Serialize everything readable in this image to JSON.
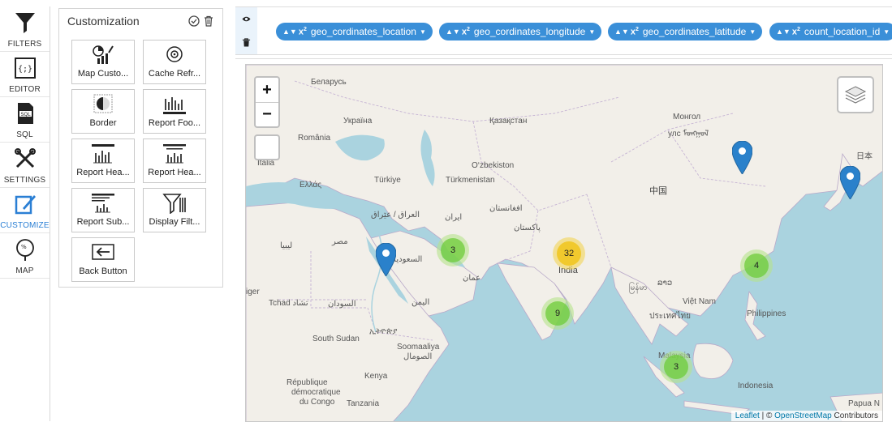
{
  "rail": {
    "items": [
      {
        "label": "FILTERS",
        "icon": "funnel-icon"
      },
      {
        "label": "EDITOR",
        "icon": "code-braces-icon"
      },
      {
        "label": "SQL",
        "icon": "sql-file-icon"
      },
      {
        "label": "SETTINGS",
        "icon": "tools-icon"
      },
      {
        "label": "CUSTOMIZE",
        "icon": "customize-edit-icon"
      },
      {
        "label": "MAP",
        "icon": "map-icon"
      }
    ]
  },
  "panel": {
    "title": "Customization",
    "tiles": [
      {
        "label": "Map Custo...",
        "icon": "map-customization-icon"
      },
      {
        "label": "Cache Refr...",
        "icon": "cache-refresh-icon"
      },
      {
        "label": "Border",
        "icon": "border-icon"
      },
      {
        "label": "Report Foo...",
        "icon": "report-footer-icon"
      },
      {
        "label": "Report Hea...",
        "icon": "report-header-icon"
      },
      {
        "label": "Report Hea...",
        "icon": "report-header-alt-icon"
      },
      {
        "label": "Report Sub...",
        "icon": "report-subheader-icon"
      },
      {
        "label": "Display Filt...",
        "icon": "display-filter-icon"
      },
      {
        "label": "Back Button",
        "icon": "back-button-icon"
      }
    ]
  },
  "chips": [
    {
      "label": "geo_cordinates_location"
    },
    {
      "label": "geo_cordinates_longitude"
    },
    {
      "label": "geo_cordinates_latitude"
    },
    {
      "label": "count_location_id"
    }
  ],
  "map": {
    "zoom_in": "+",
    "zoom_out": "−",
    "labels": {
      "belarus": "Беларусь",
      "ukraine": "Україна",
      "kazakhstan": "Қазақстан",
      "mongolia": "Монгол",
      "mongolia_script": "улс ᠮᠣᠩᠭᠣᠯ",
      "romania": "România",
      "uzbekistan": "O‘zbekiston",
      "japan": "日本",
      "italia": "Italia",
      "turkiye": "Türkiye",
      "turkmenistan": "Türkmenistan",
      "greece": "Ελλάς",
      "china": "中国",
      "iraq": "العراق / عێراق",
      "iran": "ایران",
      "afghanistan": "افغانستان",
      "pakistan": "پاکستان",
      "libya": "ليبيا",
      "egypt": "مصر",
      "saudi": "السعودية",
      "oman": "عمان",
      "india": "India",
      "myanmar": "မြန်မာ",
      "laos": "ລາວ",
      "vietnam": "Việt Nam",
      "thailand": "ประเทศไทย",
      "philippines": "Philippines",
      "niger": "iger",
      "chad": "Tchad تشاد",
      "sudan": "السودان",
      "yemen": "اليمن",
      "south_sudan": "South Sudan",
      "ethiopia": "ኢትዮጵያ",
      "somalia": "Soomaaliya",
      "somalia_ar": "الصومال",
      "kenya": "Kenya",
      "malaysia": "Malaysia",
      "drc1": "République",
      "drc2": "démocratique",
      "drc3": "du Congo",
      "tanzania": "Tanzania",
      "indonesia": "Indonesia",
      "png": "Papua N"
    },
    "clusters": [
      {
        "count": "3",
        "color": "green"
      },
      {
        "count": "32",
        "color": "yellow"
      },
      {
        "count": "9",
        "color": "green"
      },
      {
        "count": "4",
        "color": "green"
      },
      {
        "count": "3",
        "color": "green"
      }
    ],
    "marker_color": "#2a81cb",
    "attribution": {
      "leaflet": "Leaflet",
      "sep": " | © ",
      "osm": "OpenStreetMap",
      "suffix": " Contributors"
    }
  }
}
